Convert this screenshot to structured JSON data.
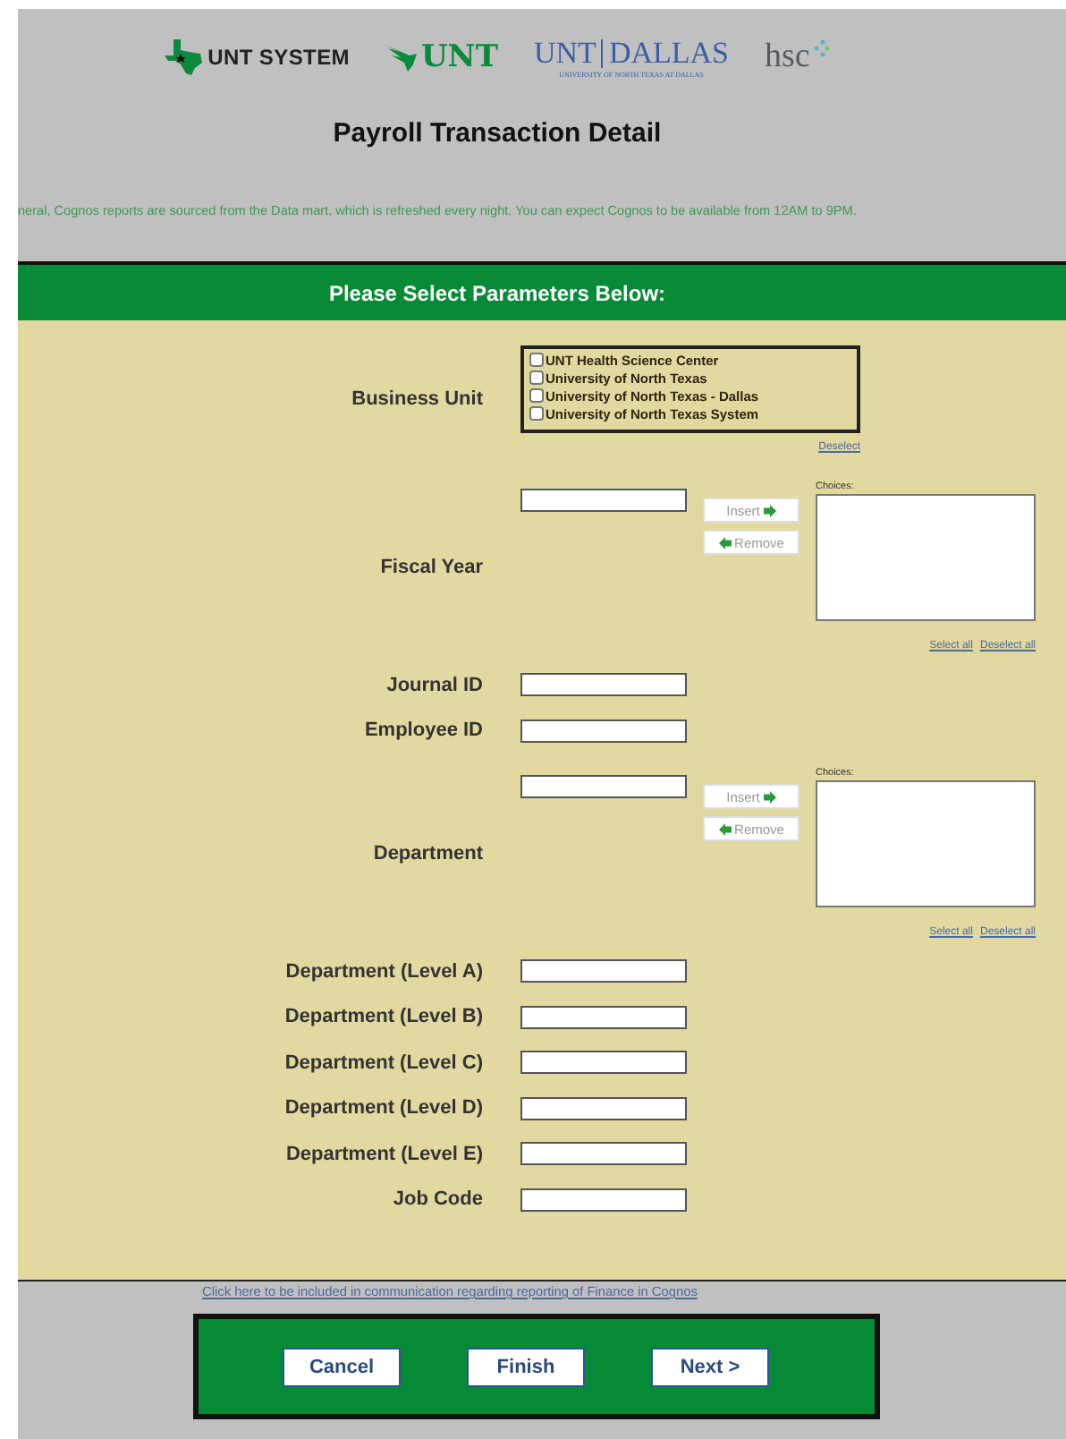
{
  "logos": {
    "system": "UNT SYSTEM",
    "unt": "UNT",
    "dallas_left": "UNT",
    "dallas_right": "DALLAS",
    "dallas_sub": "UNIVERSITY OF NORTH TEXAS AT DALLAS",
    "hsc": "hsc"
  },
  "title": "Payroll Transaction Detail",
  "notice": "neral, Cognos reports are sourced from the Data mart, which is refreshed every night. You can expect Cognos to be available from 12AM to 9PM.",
  "parameters_header": "Please Select Parameters Below:",
  "fields": [
    {
      "kind": "checklist",
      "label": "Business Unit",
      "options": [
        {
          "label": "UNT Health Science Center",
          "checked": false
        },
        {
          "label": "University of North Texas",
          "checked": false
        },
        {
          "label": "University of North Texas - Dallas",
          "checked": false
        },
        {
          "label": "University of North Texas System",
          "checked": false
        }
      ],
      "deselect": "Deselect"
    },
    {
      "kind": "picker",
      "label": "Fiscal Year",
      "insert": "Insert",
      "remove": "Remove",
      "disabled": true,
      "choices_label": "Choices:",
      "select_all": "Select all",
      "deselect_all": "Deselect all"
    },
    {
      "kind": "text",
      "label": "Journal ID"
    },
    {
      "kind": "text",
      "label": "Employee ID"
    },
    {
      "kind": "picker",
      "label": "Department",
      "insert": "Insert",
      "remove": "Remove",
      "disabled": true,
      "choices_label": "Choices:",
      "select_all": "Select all",
      "deselect_all": "Deselect all"
    },
    {
      "kind": "text",
      "label": "Department (Level A)"
    },
    {
      "kind": "text",
      "label": "Department (Level B)"
    },
    {
      "kind": "text",
      "label": "Department (Level C)"
    },
    {
      "kind": "text",
      "label": "Department (Level D)"
    },
    {
      "kind": "text",
      "label": "Department (Level E)"
    },
    {
      "kind": "text",
      "label": "Job Code"
    }
  ],
  "footer_link": "Click here to be included in communication regarding reporting of Finance in Cognos",
  "buttons": [
    "Cancel",
    "Finish",
    "Next >"
  ]
}
